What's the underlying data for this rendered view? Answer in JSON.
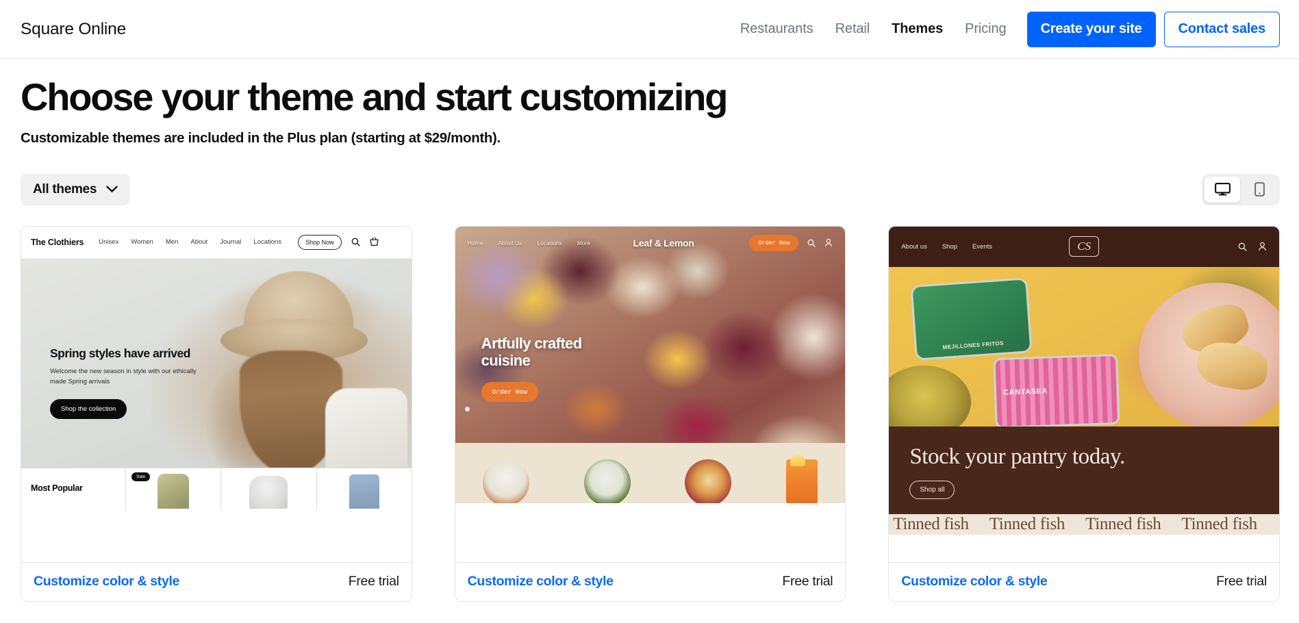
{
  "header": {
    "brand": "Square Online",
    "nav": [
      {
        "label": "Restaurants",
        "active": false
      },
      {
        "label": "Retail",
        "active": false
      },
      {
        "label": "Themes",
        "active": true
      },
      {
        "label": "Pricing",
        "active": false
      }
    ],
    "primary_cta": "Create your site",
    "secondary_cta": "Contact sales",
    "accent_color": "#0063ff"
  },
  "page": {
    "title": "Choose your theme and start customizing",
    "subtitle": "Customizable themes are included in the Plus plan (starting at $29/month)."
  },
  "filters": {
    "selected": "All themes",
    "chevron_icon": "chevron-down-icon",
    "device_toggle": {
      "desktop": {
        "icon": "desktop-icon",
        "active": true
      },
      "mobile": {
        "icon": "mobile-icon",
        "active": false
      }
    }
  },
  "cards": [
    {
      "footer_link": "Customize color & style",
      "footer_note": "Free trial",
      "site": {
        "logo": "The Clothiers",
        "nav": [
          "Unisex",
          "Women",
          "Men",
          "About",
          "Journal",
          "Locations"
        ],
        "nav_button": "Shop Now",
        "icons": [
          "search-icon",
          "cart-icon"
        ],
        "hero_title": "Spring styles have arrived",
        "hero_text": "Welcome the new season in style with our ethically made Spring arrivals",
        "hero_cta": "Shop the collection",
        "section_label": "Most Popular",
        "badge": "Sale"
      }
    },
    {
      "footer_link": "Customize color & style",
      "footer_note": "Free trial",
      "site": {
        "logo": "Leaf & Lemon",
        "nav": [
          "Home",
          "About Us",
          "Locations",
          "More"
        ],
        "nav_button": "Order Now",
        "icons": [
          "search-icon",
          "account-icon"
        ],
        "hero_title": "Artfully crafted cuisine",
        "hero_cta": "Order Now"
      }
    },
    {
      "footer_link": "Customize color & style",
      "footer_note": "Free trial",
      "site": {
        "logo": "CS",
        "nav": [
          "About us",
          "Shop",
          "Events"
        ],
        "icons": [
          "search-icon",
          "account-icon"
        ],
        "hero_title": "Stock your pantry today.",
        "hero_cta": "Shop all",
        "product_labels": [
          "MEJILLONES FRITOS",
          "CANTASEA"
        ],
        "marquee": [
          "Tinned fish",
          "Tinned fish",
          "Tinned fish",
          "Tinned fish"
        ]
      }
    }
  ]
}
